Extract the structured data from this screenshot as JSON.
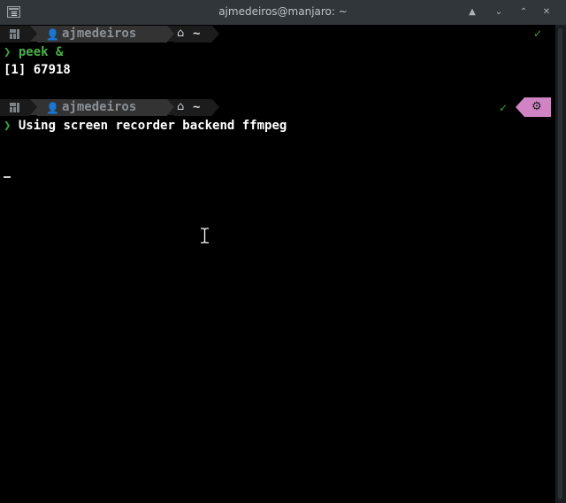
{
  "window": {
    "title": "ajmedeiros@manjaro: ~",
    "buttons": {
      "keep_above": "▲",
      "minimize": "⌄",
      "maximize": "⌃",
      "close": "✕"
    }
  },
  "prompts": [
    {
      "user": "ajmedeiros",
      "dir": "~",
      "status_check": "✓",
      "command": "peek &"
    },
    {
      "user": "ajmedeiros",
      "dir": "~",
      "status_check": "✓",
      "background_jobs_icon": "gear-icon"
    }
  ],
  "output": {
    "job_line": "[1] 67918",
    "backend_line": "Using screen recorder backend ffmpeg"
  },
  "icons": {
    "prompt_chevron": "❯",
    "user": "user-icon",
    "home": "home-icon",
    "distro": "manjaro-icon"
  },
  "colors": {
    "prompt_green": "#4caf4c",
    "jobs_segment": "#d184c4",
    "titlebar": "#31363b"
  }
}
